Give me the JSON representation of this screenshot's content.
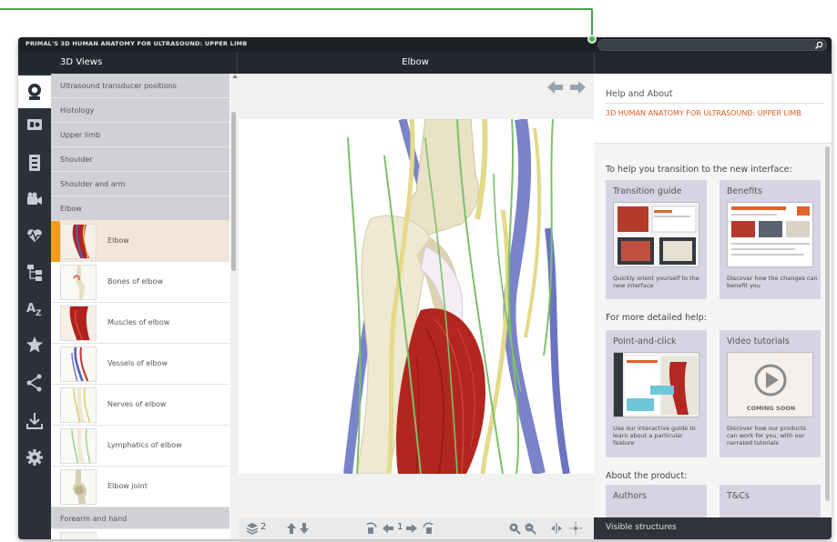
{
  "app": {
    "title": "PRIMAL'S 3D HUMAN ANATOMY FOR ULTRASOUND: UPPER LIMB",
    "search_placeholder": ""
  },
  "header": {
    "left_title": "3D Views",
    "center_title": "Elbow"
  },
  "rail": {
    "items": [
      {
        "name": "3d-views-icon",
        "active": true
      },
      {
        "name": "slides-icon",
        "active": false
      },
      {
        "name": "quiz-icon",
        "active": false
      },
      {
        "name": "video-icon",
        "active": false
      },
      {
        "name": "heartbeat-icon",
        "active": false
      },
      {
        "name": "hierarchy-icon",
        "active": false
      },
      {
        "name": "a-z-index-icon",
        "active": false
      },
      {
        "name": "favorites-star-icon",
        "active": false
      },
      {
        "name": "share-icon",
        "active": false
      },
      {
        "name": "download-icon",
        "active": false
      },
      {
        "name": "settings-gear-icon",
        "active": false
      }
    ]
  },
  "list": {
    "categories_top": [
      "Ultrasound transducer positions",
      "Histology",
      "Upper limb",
      "Shoulder",
      "Shoulder and arm",
      "Elbow"
    ],
    "items": [
      {
        "label": "Elbow",
        "selected": true
      },
      {
        "label": "Bones of elbow",
        "selected": false
      },
      {
        "label": "Muscles of elbow",
        "selected": false
      },
      {
        "label": "Vessels of elbow",
        "selected": false
      },
      {
        "label": "Nerves of elbow",
        "selected": false
      },
      {
        "label": "Lymphatics of elbow",
        "selected": false
      },
      {
        "label": "Elbow joint",
        "selected": false
      }
    ],
    "category_bottom": "Forearm and hand"
  },
  "toolbar": {
    "layers_count": "2",
    "page_number": "1"
  },
  "help": {
    "heading": "Help and About",
    "product_title": "3D HUMAN ANATOMY FOR ULTRASOUND: UPPER LIMB",
    "section1": "To help you transition to the new interface:",
    "section2": "For more detailed help:",
    "section3": "About the product:",
    "cards": {
      "transition": {
        "title": "Transition guide",
        "desc": "Quickly orient yourself to the new interface"
      },
      "benefits": {
        "title": "Benefits",
        "desc": "Discover how the changes can benefit you"
      },
      "point": {
        "title": "Point-and-click",
        "desc": "Use our interactive guide to learn about a particular feature"
      },
      "video": {
        "title": "Video tutorials",
        "desc": "Discover how our products can work for you, with our narrated tutorials",
        "overlay": "COMING SOON"
      },
      "authors": {
        "title": "Authors"
      },
      "tcs": {
        "title": "T&Cs"
      }
    },
    "visible_structures": "Visible structures"
  },
  "colors": {
    "accent_orange": "#f29b1d",
    "product_title": "#e05a1e",
    "callout_green": "#49a34a",
    "card_lavender": "#d7d3e3"
  }
}
